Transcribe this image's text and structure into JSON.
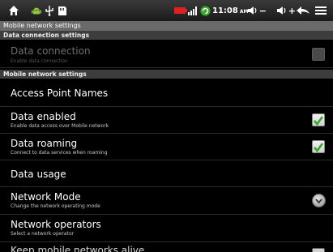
{
  "status_bar": {
    "time": "11:08",
    "ampm": "AM",
    "icons": [
      "home-icon",
      "android-icon",
      "usb-icon",
      "sd-card-icon",
      "battery-icon",
      "signal-bars-icon",
      "sync-icon",
      "volume-down-icon",
      "volume-up-icon",
      "back-icon",
      "menu-icon"
    ],
    "vol_minus": "−",
    "vol_plus": "+"
  },
  "window_title": "Mobile network settings",
  "sections": [
    {
      "header": "Data connection settings",
      "items": [
        {
          "title": "Data connection",
          "subtitle": "Enable data connection",
          "control": "checkbox",
          "checked": false,
          "enabled": false
        }
      ]
    },
    {
      "header": "Mobile network settings",
      "items": [
        {
          "title": "Access Point Names",
          "subtitle": "",
          "control": "none",
          "enabled": true
        },
        {
          "title": "Data enabled",
          "subtitle": "Enable data access over Mobile network",
          "control": "checkbox",
          "checked": true,
          "enabled": true
        },
        {
          "title": "Data roaming",
          "subtitle": "Connect to data services when roaming",
          "control": "checkbox",
          "checked": true,
          "enabled": true
        },
        {
          "title": "Data usage",
          "subtitle": "",
          "control": "none",
          "enabled": true
        },
        {
          "title": "Network Mode",
          "subtitle": "Change the network operating mode",
          "control": "dropdown",
          "enabled": true
        },
        {
          "title": "Network operators",
          "subtitle": "Select a network operator",
          "control": "none",
          "enabled": true
        },
        {
          "title": "Keep mobile networks alive",
          "subtitle": "",
          "control": "checkbox",
          "checked": false,
          "enabled": true
        }
      ]
    }
  ],
  "colors": {
    "check_green": "#3aa62f",
    "section_bg": "#3d3d3d",
    "title_bar": "#6a6a6a"
  }
}
